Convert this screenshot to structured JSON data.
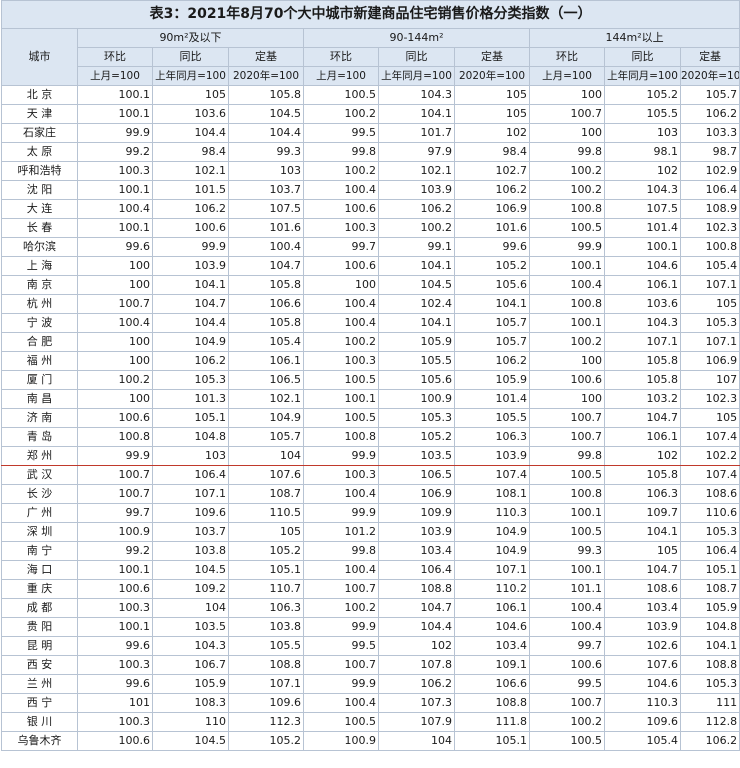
{
  "title": "表3：2021年8月70个大中城市新建商品住宅销售价格分类指数（一）",
  "header": {
    "city": "城市",
    "groups": [
      "90m²及以下",
      "90-144m²",
      "144m²以上"
    ],
    "cols": [
      "环比",
      "同比",
      "定基"
    ],
    "bases": [
      "上月=100",
      "上年同月=100",
      "2020年=100"
    ]
  },
  "highlight_city": "郑州",
  "rows": [
    [
      "北  京",
      "100.1",
      "105",
      "105.8",
      "100.5",
      "104.3",
      "105",
      "100",
      "105.2",
      "105.7"
    ],
    [
      "天  津",
      "100.1",
      "103.6",
      "104.5",
      "100.2",
      "104.1",
      "105",
      "100.7",
      "105.5",
      "106.2"
    ],
    [
      "石家庄",
      "99.9",
      "104.4",
      "104.4",
      "99.5",
      "101.7",
      "102",
      "100",
      "103",
      "103.3"
    ],
    [
      "太  原",
      "99.2",
      "98.4",
      "99.3",
      "99.8",
      "97.9",
      "98.4",
      "99.8",
      "98.1",
      "98.7"
    ],
    [
      "呼和浩特",
      "100.3",
      "102.1",
      "103",
      "100.2",
      "102.1",
      "102.7",
      "100.2",
      "102",
      "102.9"
    ],
    [
      "沈  阳",
      "100.1",
      "101.5",
      "103.7",
      "100.4",
      "103.9",
      "106.2",
      "100.2",
      "104.3",
      "106.4"
    ],
    [
      "大  连",
      "100.4",
      "106.2",
      "107.5",
      "100.6",
      "106.2",
      "106.9",
      "100.8",
      "107.5",
      "108.9"
    ],
    [
      "长  春",
      "100.1",
      "100.6",
      "101.6",
      "100.3",
      "100.2",
      "101.6",
      "100.5",
      "101.4",
      "102.3"
    ],
    [
      "哈尔滨",
      "99.6",
      "99.9",
      "100.4",
      "99.7",
      "99.1",
      "99.6",
      "99.9",
      "100.1",
      "100.8"
    ],
    [
      "上  海",
      "100",
      "103.9",
      "104.7",
      "100.6",
      "104.1",
      "105.2",
      "100.1",
      "104.6",
      "105.4"
    ],
    [
      "南  京",
      "100",
      "104.1",
      "105.8",
      "100",
      "104.5",
      "105.6",
      "100.4",
      "106.1",
      "107.1"
    ],
    [
      "杭  州",
      "100.7",
      "104.7",
      "106.6",
      "100.4",
      "102.4",
      "104.1",
      "100.8",
      "103.6",
      "105"
    ],
    [
      "宁  波",
      "100.4",
      "104.4",
      "105.8",
      "100.4",
      "104.1",
      "105.7",
      "100.1",
      "104.3",
      "105.3"
    ],
    [
      "合  肥",
      "100",
      "104.9",
      "105.4",
      "100.2",
      "105.9",
      "105.7",
      "100.2",
      "107.1",
      "107.1"
    ],
    [
      "福  州",
      "100",
      "106.2",
      "106.1",
      "100.3",
      "105.5",
      "106.2",
      "100",
      "105.8",
      "106.9"
    ],
    [
      "厦  门",
      "100.2",
      "105.3",
      "106.5",
      "100.5",
      "105.6",
      "105.9",
      "100.6",
      "105.8",
      "107"
    ],
    [
      "南  昌",
      "100",
      "101.3",
      "102.1",
      "100.1",
      "100.9",
      "101.4",
      "100",
      "103.2",
      "102.3"
    ],
    [
      "济  南",
      "100.6",
      "105.1",
      "104.9",
      "100.5",
      "105.3",
      "105.5",
      "100.7",
      "104.7",
      "105"
    ],
    [
      "青  岛",
      "100.8",
      "104.8",
      "105.7",
      "100.8",
      "105.2",
      "106.3",
      "100.7",
      "106.1",
      "107.4"
    ],
    [
      "郑  州",
      "99.9",
      "103",
      "104",
      "99.9",
      "103.5",
      "103.9",
      "99.8",
      "102",
      "102.2"
    ],
    [
      "武  汉",
      "100.7",
      "106.4",
      "107.6",
      "100.3",
      "106.5",
      "107.4",
      "100.5",
      "105.8",
      "107.4"
    ],
    [
      "长  沙",
      "100.7",
      "107.1",
      "108.7",
      "100.4",
      "106.9",
      "108.1",
      "100.8",
      "106.3",
      "108.6"
    ],
    [
      "广  州",
      "99.7",
      "109.6",
      "110.5",
      "99.9",
      "109.9",
      "110.3",
      "100.1",
      "109.7",
      "110.6"
    ],
    [
      "深  圳",
      "100.9",
      "103.7",
      "105",
      "101.2",
      "103.9",
      "104.9",
      "100.5",
      "104.1",
      "105.3"
    ],
    [
      "南  宁",
      "99.2",
      "103.8",
      "105.2",
      "99.8",
      "103.4",
      "104.9",
      "99.3",
      "105",
      "106.4"
    ],
    [
      "海  口",
      "100.1",
      "104.5",
      "105.1",
      "100.4",
      "106.4",
      "107.1",
      "100.1",
      "104.7",
      "105.1"
    ],
    [
      "重  庆",
      "100.6",
      "109.2",
      "110.7",
      "100.7",
      "108.8",
      "110.2",
      "101.1",
      "108.6",
      "108.7"
    ],
    [
      "成  都",
      "100.3",
      "104",
      "106.3",
      "100.2",
      "104.7",
      "106.1",
      "100.4",
      "103.4",
      "105.9"
    ],
    [
      "贵  阳",
      "100.1",
      "103.5",
      "103.8",
      "99.9",
      "104.4",
      "104.6",
      "100.4",
      "103.9",
      "104.8"
    ],
    [
      "昆  明",
      "99.6",
      "104.3",
      "105.5",
      "99.5",
      "102",
      "103.4",
      "99.7",
      "102.6",
      "104.1"
    ],
    [
      "西  安",
      "100.3",
      "106.7",
      "108.8",
      "100.7",
      "107.8",
      "109.1",
      "100.6",
      "107.6",
      "108.8"
    ],
    [
      "兰  州",
      "99.6",
      "105.9",
      "107.1",
      "99.9",
      "106.2",
      "106.6",
      "99.5",
      "104.6",
      "105.3"
    ],
    [
      "西  宁",
      "101",
      "108.3",
      "109.6",
      "100.4",
      "107.3",
      "108.8",
      "100.7",
      "110.3",
      "111"
    ],
    [
      "银  川",
      "100.3",
      "110",
      "112.3",
      "100.5",
      "107.9",
      "111.8",
      "100.2",
      "109.6",
      "112.8"
    ],
    [
      "乌鲁木齐",
      "100.6",
      "104.5",
      "105.2",
      "100.9",
      "104",
      "105.1",
      "100.5",
      "105.4",
      "106.2"
    ]
  ]
}
